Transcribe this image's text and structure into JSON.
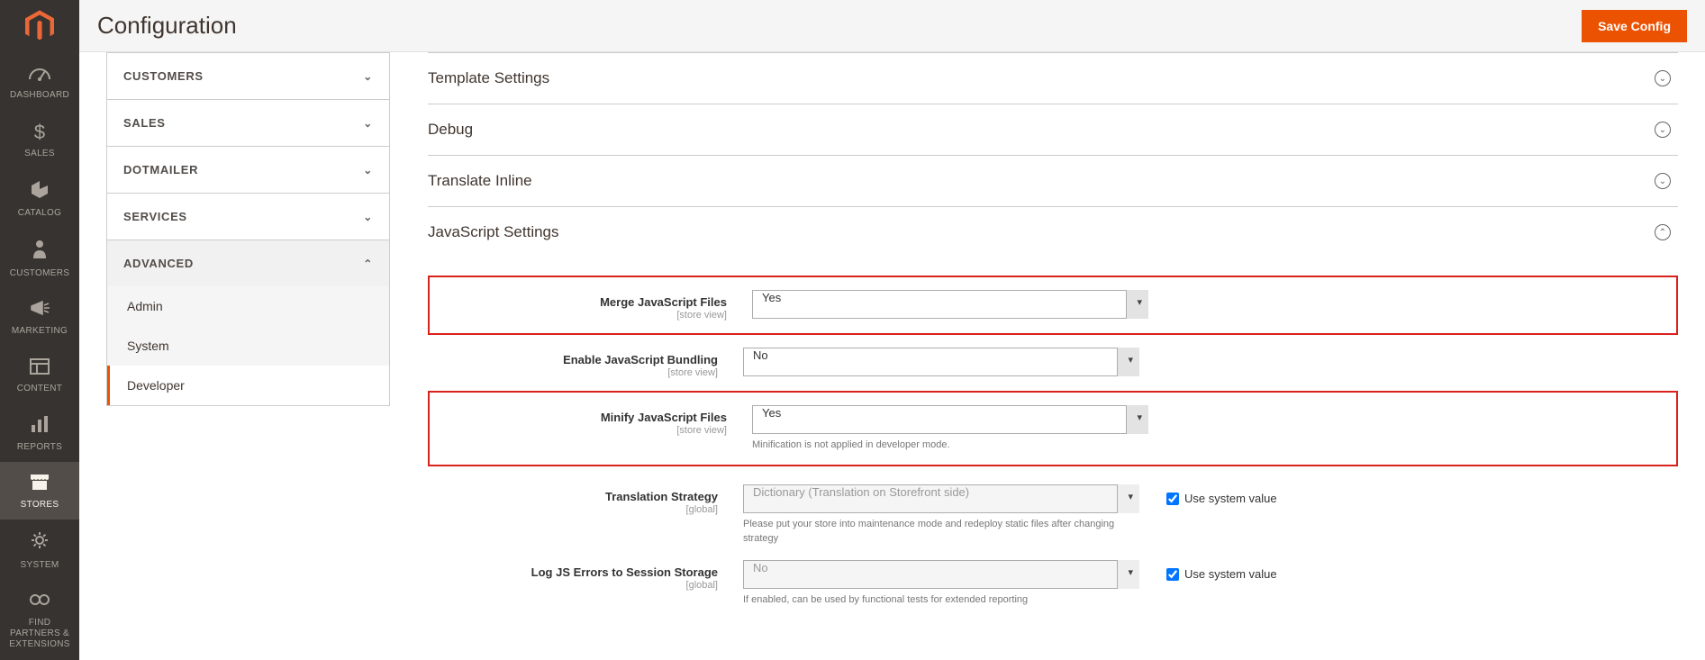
{
  "header": {
    "title": "Configuration",
    "save_label": "Save Config"
  },
  "nav": {
    "items": [
      {
        "label": "DASHBOARD"
      },
      {
        "label": "SALES"
      },
      {
        "label": "CATALOG"
      },
      {
        "label": "CUSTOMERS"
      },
      {
        "label": "MARKETING"
      },
      {
        "label": "CONTENT"
      },
      {
        "label": "REPORTS"
      },
      {
        "label": "STORES"
      },
      {
        "label": "SYSTEM"
      },
      {
        "label": "FIND PARTNERS & EXTENSIONS"
      }
    ]
  },
  "config_tabs": {
    "groups": [
      {
        "label": "CUSTOMERS",
        "expanded": false
      },
      {
        "label": "SALES",
        "expanded": false
      },
      {
        "label": "DOTMAILER",
        "expanded": false
      },
      {
        "label": "SERVICES",
        "expanded": false
      },
      {
        "label": "ADVANCED",
        "expanded": true,
        "items": [
          {
            "label": "Admin",
            "active": false
          },
          {
            "label": "System",
            "active": false
          },
          {
            "label": "Developer",
            "active": true
          }
        ]
      }
    ]
  },
  "sections": {
    "template": {
      "title": "Template Settings"
    },
    "debug": {
      "title": "Debug"
    },
    "translate_inline": {
      "title": "Translate Inline"
    },
    "javascript": {
      "title": "JavaScript Settings",
      "fields": {
        "merge_js": {
          "label": "Merge JavaScript Files",
          "scope": "[store view]",
          "value": "Yes"
        },
        "bundling": {
          "label": "Enable JavaScript Bundling",
          "scope": "[store view]",
          "value": "No"
        },
        "minify_js": {
          "label": "Minify JavaScript Files",
          "scope": "[store view]",
          "value": "Yes",
          "help": "Minification is not applied in developer mode."
        },
        "translation_strategy": {
          "label": "Translation Strategy",
          "scope": "[global]",
          "value": "Dictionary (Translation on Storefront side)",
          "help": "Please put your store into maintenance mode and redeploy static files after changing strategy",
          "use_system_label": "Use system value"
        },
        "log_errors": {
          "label": "Log JS Errors to Session Storage",
          "scope": "[global]",
          "value": "No",
          "help": "If enabled, can be used by functional tests for extended reporting",
          "use_system_label": "Use system value"
        }
      }
    }
  }
}
